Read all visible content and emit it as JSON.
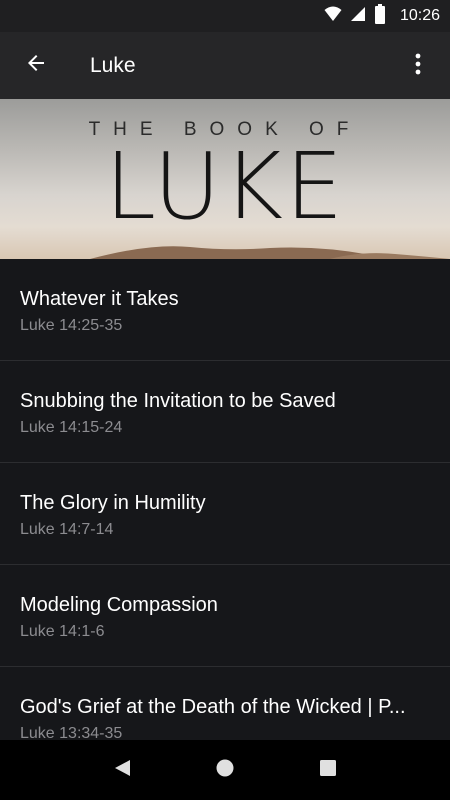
{
  "status_bar": {
    "time": "10:26",
    "icons": [
      "wifi-icon",
      "cell-signal-icon",
      "battery-icon"
    ]
  },
  "app_bar": {
    "title": "Luke",
    "back_icon": "arrow-back-icon",
    "menu_icon": "more-vert-icon"
  },
  "hero": {
    "subtitle": "THE BOOK OF",
    "title": "LUKE"
  },
  "sermons": [
    {
      "title": "Whatever it Takes",
      "reference": "Luke 14:25-35"
    },
    {
      "title": "Snubbing the Invitation to be Saved",
      "reference": "Luke 14:15-24"
    },
    {
      "title": "The Glory in Humility",
      "reference": "Luke 14:7-14"
    },
    {
      "title": "Modeling Compassion",
      "reference": "Luke 14:1-6"
    },
    {
      "title": "God's Grief at the Death of the Wicked | P...",
      "reference": "Luke 13:34-35"
    }
  ],
  "nav_bar": {
    "icons": [
      "back-triangle-icon",
      "home-circle-icon",
      "recents-square-icon"
    ]
  },
  "colors": {
    "background": "#16171a",
    "app_bar": "#262628",
    "status_bar": "#1f1f21",
    "subtitle_text": "#8c8c90"
  }
}
